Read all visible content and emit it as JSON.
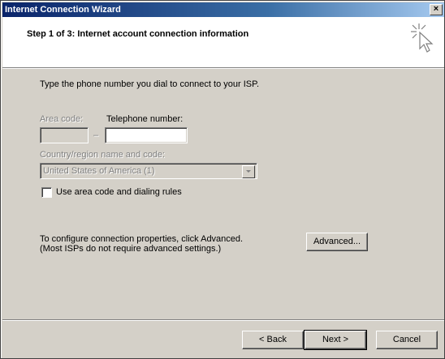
{
  "window": {
    "title": "Internet Connection Wizard",
    "close_glyph": "×"
  },
  "header": {
    "step_title": "Step 1 of 3: Internet account connection information",
    "icon": "wizard-cursor-icon"
  },
  "instructions": "Type the phone number you dial to connect to your ISP.",
  "form": {
    "area_code_label": "Area code:",
    "area_code_value": "",
    "dash": "–",
    "telephone_label": "Telephone number:",
    "telephone_value": "",
    "country_label": "Country/region name and code:",
    "country_value": "United States of America (1)",
    "use_area_code_label": "Use area code and dialing rules",
    "use_area_code_checked": false
  },
  "advanced": {
    "line1": "To configure connection properties, click Advanced.",
    "line2": "(Most ISPs do not require advanced settings.)",
    "button_label": "Advanced..."
  },
  "footer": {
    "back_label": "< Back",
    "next_label": "Next >",
    "cancel_label": "Cancel"
  }
}
